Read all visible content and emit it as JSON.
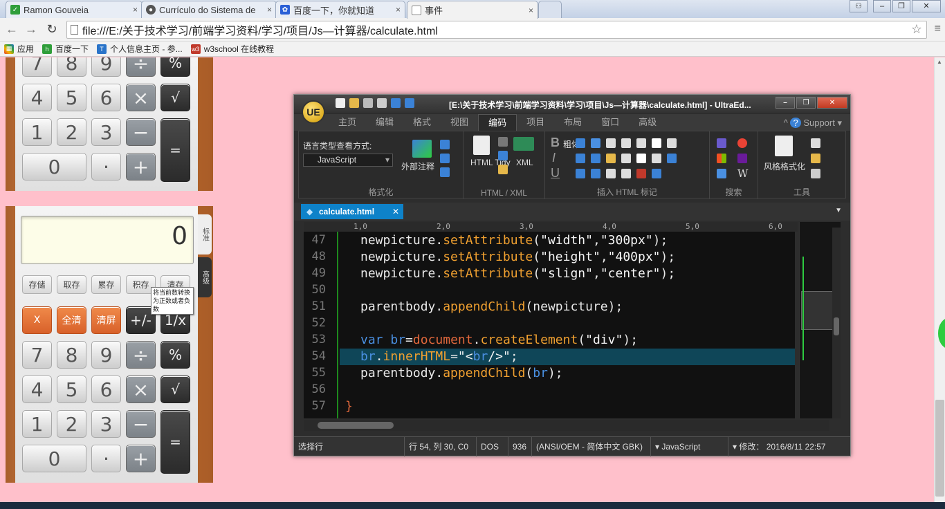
{
  "browser": {
    "tabs": [
      {
        "title": "Ramon Gouveia",
        "icon": "checkbox-icon"
      },
      {
        "title": "Currículo do Sistema de",
        "icon": "globe-icon"
      },
      {
        "title": "百度一下，你就知道",
        "icon": "baidu-paw-icon"
      },
      {
        "title": "事件",
        "icon": "page-icon"
      }
    ],
    "url": "file:///E:/关于技术学习/前端学习资料/学习/项目/Js—计算器/calculate.html",
    "bookmarks": [
      {
        "label": "应用",
        "icon": "apps-grid-icon",
        "color": "#e03c31"
      },
      {
        "label": "百度一下",
        "icon": "hao123-icon",
        "color": "#2f9e3a"
      },
      {
        "label": "个人信息主页 - 参...",
        "icon": "t-logo-icon",
        "color": "#2a74c9"
      },
      {
        "label": "w3school 在线教程",
        "icon": "w3-icon",
        "color": "#c0392b"
      }
    ]
  },
  "calculator_top": {
    "rows": [
      [
        "7",
        "8",
        "9",
        "÷",
        "%"
      ],
      [
        "4",
        "5",
        "6",
        "×",
        "√"
      ],
      [
        "1",
        "2",
        "3",
        "−",
        "="
      ],
      [
        "0",
        "·",
        "+"
      ]
    ]
  },
  "calculator_bottom": {
    "display": "0",
    "side_tabs": [
      "标准",
      "高级"
    ],
    "memory": [
      "存储",
      "取存",
      "累存",
      "积存",
      "清存"
    ],
    "tooltip": "将当前数转换为正数或者负数",
    "func_row": [
      "X",
      "全清",
      "清屏",
      "+/-",
      "1/x"
    ],
    "rows": [
      [
        "7",
        "8",
        "9",
        "÷",
        "%"
      ],
      [
        "4",
        "5",
        "6",
        "×",
        "√"
      ],
      [
        "1",
        "2",
        "3",
        "−",
        "="
      ],
      [
        "0",
        "·",
        "+"
      ]
    ]
  },
  "ultraedit": {
    "title": "[E:\\关于技术学习\\前端学习资料\\学习\\项目\\Js—计算器\\calculate.html] - UltraEd...",
    "logo": "UE",
    "menus": [
      "主页",
      "编辑",
      "格式",
      "视图",
      "编码",
      "项目",
      "布局",
      "窗口",
      "高级"
    ],
    "active_menu": "编码",
    "support": "Support",
    "ribbon": {
      "lang_view_label": "语言类型查看方式:",
      "lang_value": "JavaScript",
      "external_comment": "外部注释",
      "html_tidy": "HTML Tidy",
      "xml": "XML",
      "bold": "粗体",
      "style_format": "风格格式化",
      "groups": [
        "格式化",
        "HTML / XML",
        "插入 HTML 标记",
        "搜索",
        "工具"
      ]
    },
    "file_tab": "calculate.html",
    "ruler": [
      "1,0",
      "2,0",
      "3,0",
      "4,0",
      "5,0",
      "6,0"
    ],
    "code_lines": [
      {
        "n": "47",
        "text": "newpicture.setAttribute(\"width\",\"300px\");"
      },
      {
        "n": "48",
        "text": "newpicture.setAttribute(\"height\",\"400px\");"
      },
      {
        "n": "49",
        "text": "newpicture.setAttribute(\"slign\",\"center\");"
      },
      {
        "n": "50",
        "text": ""
      },
      {
        "n": "51",
        "text": "parentbody.appendChild(newpicture);"
      },
      {
        "n": "52",
        "text": ""
      },
      {
        "n": "53",
        "text": "var br=document.createElement(\"div\");"
      },
      {
        "n": "54",
        "text": "br.innerHTML=\"<br/>\";"
      },
      {
        "n": "55",
        "text": "parentbody.appendChild(br);"
      },
      {
        "n": "56",
        "text": ""
      },
      {
        "n": "57",
        "text": "}"
      }
    ],
    "status": {
      "mode": "选择行",
      "position": "行 54, 列 30, C0",
      "line_end": "DOS",
      "codepage": "936",
      "encoding": "(ANSI/OEM - 简体中文 GBK)",
      "language": "JavaScript",
      "modified": "修改： 2016/8/11 22:57"
    }
  }
}
